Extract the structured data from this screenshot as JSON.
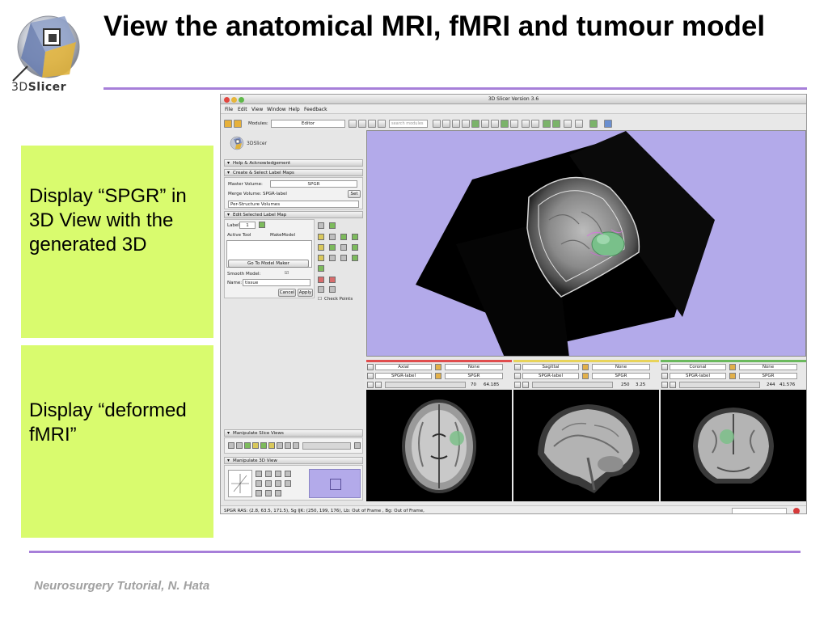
{
  "slide": {
    "title": "View the anatomical MRI, fMRI and tumour model",
    "logo_text_prefix": "3D",
    "logo_text_suffix": "Slicer",
    "footer": "Neurosurgery Tutorial, N. Hata",
    "accent_color": "#a77fd9",
    "callout_color": "#d9fb6e",
    "callouts": [
      {
        "text": "Display “SPGR” in 3D View with the generated 3D"
      },
      {
        "text": "Display “deformed fMRI”"
      }
    ]
  },
  "app": {
    "window_title": "3D Slicer Version 3.6",
    "menu": [
      "File",
      "Edit",
      "View",
      "Window",
      "Help",
      "Feedback"
    ],
    "toolbar": {
      "modules_label": "Modules:",
      "module_selected": "Editor",
      "search_placeholder": "search modules"
    },
    "panel": {
      "logo_text": "3DSlicer",
      "sections": {
        "help": "Help & Acknowledgement",
        "create_select": "Create & Select Label Maps",
        "edit_selected": "Edit Selected Label Map",
        "manipulate_slice": "Manipulate Slice Views",
        "manipulate_3d": "Manipulate 3D View"
      },
      "master_volume_label": "Master Volume:",
      "master_volume_value": "SPGR",
      "merge_volume_label": "Merge Volume: SPGR-label",
      "set_button": "Set",
      "per_structure": "Per-Structure Volumes",
      "label_label": "Label",
      "label_value": "1",
      "active_tool_label": "Active Tool",
      "active_tool_value": "MakeModel",
      "go_to_model_maker": "Go To Model Maker",
      "smooth_model_label": "Smooth Model:",
      "name_label": "Name:",
      "name_value": "tissue",
      "cancel_button": "Cancel",
      "apply_button": "Apply",
      "check_points": "Check Points"
    },
    "slices": [
      {
        "orientation": "Axial",
        "fg": "None",
        "label": "SPGR-label",
        "bg": "SPGR",
        "index": "70",
        "offset": "64.185",
        "bar_color": "#e04d4d"
      },
      {
        "orientation": "Sagittal",
        "fg": "None",
        "label": "SPGR-label",
        "bg": "SPGR",
        "index": "250",
        "offset": "3.25",
        "bar_color": "#e8d35a"
      },
      {
        "orientation": "Coronal",
        "fg": "None",
        "label": "SPGR-label",
        "bg": "SPGR",
        "index": "244",
        "offset": "41.576",
        "bar_color": "#6bb95d"
      }
    ],
    "status_text": "SPGR RAS: (2.8, 63.5, 171.5), Sg IJK: (250, 199, 176), Lb: Out of Frame , Bg: Out of Frame,"
  }
}
